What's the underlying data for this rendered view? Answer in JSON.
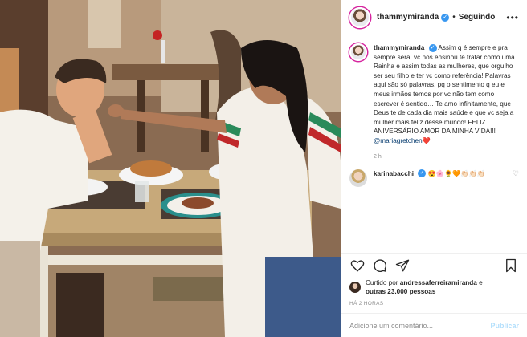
{
  "post": {
    "author": {
      "username": "thammymiranda",
      "verified": true,
      "follow_state": "Seguindo"
    },
    "caption": {
      "username": "thammymiranda",
      "text": "Assim q é sempre e pra sempre será, vc nos ensinou te tratar como uma Rainha e assim todas as mulheres, que orgulho ser seu filho e ter vc como referência! Palavras aqui são só palavras, pq o sentimento q eu e meus irmãos temos por vc não tem como escrever é sentido… Te amo infinitamente, que Deus te de cada dia mais saúde e que vc seja a mulher mais feliz desse mundo! FELIZ ANIVERSÁRIO AMOR DA MINHA VIDA!!!",
      "mention": "@mariagretchen",
      "emoji": "❤️",
      "time": "2 h"
    },
    "comments": [
      {
        "username": "karinabacchi",
        "verified": true,
        "text": "😍🌸🌻🧡👏🏻👏🏻👏🏻"
      }
    ],
    "likes": {
      "prefix": "Curtido por",
      "user": "andressaferreiramiranda",
      "joiner": "e",
      "others": "outras 23.000 pessoas"
    },
    "timestamp": "HÁ 2 HORAS",
    "add_comment": {
      "placeholder": "Adicione um comentário...",
      "publish": "Publicar"
    },
    "icons": [
      "heart-icon",
      "comment-icon",
      "share-icon",
      "bookmark-icon",
      "more-icon",
      "verified-icon"
    ],
    "colors": {
      "verified": "#3897f0",
      "mention": "#00376b",
      "publish_disabled": "#b2dffc",
      "meta": "#8e8e8e"
    }
  }
}
